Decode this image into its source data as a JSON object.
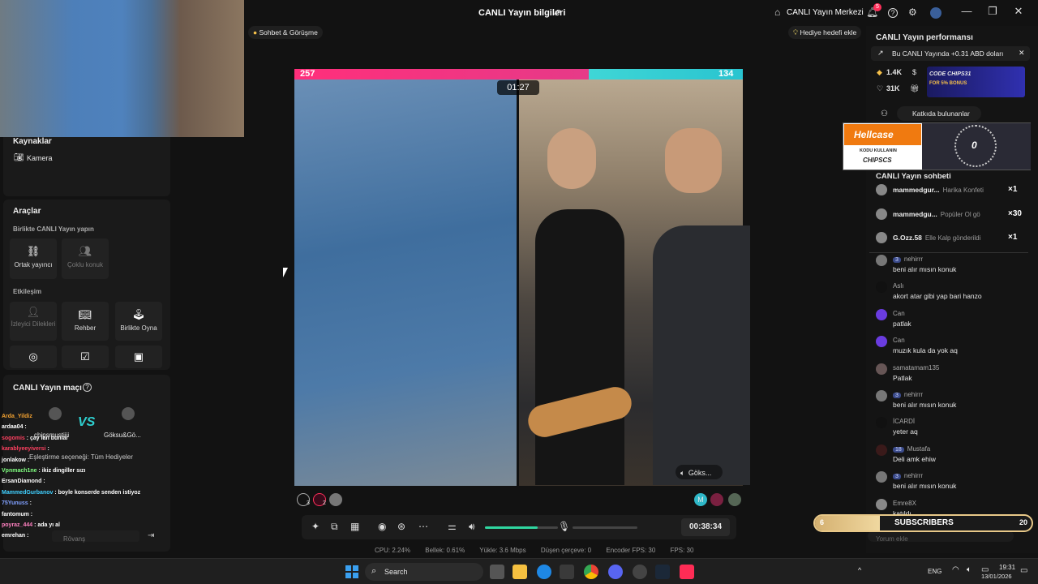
{
  "titlebar": {
    "title": "CANLI Yayın bilgileri",
    "live_center": "CANLI Yayın Merkezi",
    "notification_count": "5",
    "win_minimize": "—",
    "win_maximize": "❐",
    "win_close": "✕"
  },
  "top_pills": {
    "chat_call": "Sohbet & Görüşme",
    "gift_goal": "Hediye hedefi ekle"
  },
  "left": {
    "sources_title": "Kaynaklar",
    "camera_label": "Kamera",
    "tools_title": "Araçlar",
    "together_label": "Birlikte CANLI Yayın yapın",
    "cohost": "Ortak yayıncı",
    "multi_guest": "Çoklu konuk",
    "interaction_label": "Etkileşim",
    "viewer_requests": "İzleyici Dilekleri",
    "guide": "Rehber",
    "play_together": "Birlikte Oyna",
    "match_title": "CANLI Yayın maçı",
    "player1": "chipsmustiiii",
    "player2": "Göksu&Gö...",
    "vs": "VS",
    "rematch_placeholder": "Rövanş",
    "matching_option": "Eşleştirme seçeneği: Tüm Hediyeler"
  },
  "overlay_chat": [
    {
      "name": "Arda_Yildiz",
      "text": "",
      "color": "#f0a030"
    },
    {
      "name": "ardaa04",
      "text": ":",
      "color": "#ffffff"
    },
    {
      "name": "sogomis",
      "text": ": çay lan bunlar",
      "color": "#ff4060"
    },
    {
      "name": "karablyeeyiversi",
      "text": ":",
      "color": "#ff4060"
    },
    {
      "name": "jonlakow",
      "text": ":",
      "color": "#ffffff"
    },
    {
      "name": "Vpnmach1ne",
      "text": ": ikiz dingiller sızı",
      "color": "#80ff80"
    },
    {
      "name": "ErsanDiamond",
      "text": ":",
      "color": "#ffffff"
    },
    {
      "name": "MammedGurbanov",
      "text": ": boyle konserde senden istiyoz",
      "color": "#40d0ff"
    },
    {
      "name": "75Yunuss",
      "text": ":",
      "color": "#80a0ff"
    },
    {
      "name": "fantomum",
      "text": ":",
      "color": "#ffffff"
    },
    {
      "name": "poyraz_444",
      "text": ": ada yı al",
      "color": "#ff80c0"
    },
    {
      "name": "emrehan",
      "text": ":",
      "color": "#ffffff"
    }
  ],
  "stage": {
    "score_left": "257",
    "score_right": "134",
    "timer": "01:27",
    "guest_label": "Göks...",
    "left_badge_1": "3",
    "left_badge_2": "2",
    "right_badge": "M"
  },
  "controls": {
    "elapsed": "00:38:34",
    "volume_level": 0.72
  },
  "stats": {
    "cpu": "CPU: 2.24%",
    "memory": "Bellek: 0.61%",
    "upload": "Yükle: 3.6 Mbps",
    "dropped": "Düşen çerçeve: 0",
    "encoder_fps": "Encoder FPS: 30",
    "fps": "FPS: 30"
  },
  "right": {
    "perf_title": "CANLI Yayın performansı",
    "earnings": "Bu CANLI Yayında +0.31 ABD doları",
    "diamonds": "1.4K",
    "likes": "31K",
    "contributors": "Katkıda bulunanlar",
    "code_ad_1": "CODE CHIPS31",
    "code_ad_2": "FOR 5% BONUS",
    "hellcase_title": "Hellcase",
    "hellcase_sub1": "KODU KULLANIN",
    "hellcase_sub2": "CHIPSCS",
    "hellcase_counter": "0",
    "chat_title": "CANLI Yayın sohbeti",
    "gifts": [
      {
        "name": "mammedgur...",
        "text": "Harika Konfeti",
        "count": "×1"
      },
      {
        "name": "mammedgu...",
        "text": "Popüler Ol gö",
        "count": "×30"
      },
      {
        "name": "G.Ozz.58",
        "text": "Elle Kalp gönderildi",
        "count": "×1"
      }
    ],
    "messages": [
      {
        "name": "nehirrr",
        "badge": "3",
        "text": "beni alır mısın konuk",
        "avatar": "#777777"
      },
      {
        "name": "Aslı",
        "badge": "",
        "text": "akort atar gibi yap bari hanzo",
        "avatar": "#111111"
      },
      {
        "name": "Can",
        "badge": "",
        "text": "patlak",
        "avatar": "#6a3ce0"
      },
      {
        "name": "Can",
        "badge": "",
        "text": "muzık kula da yok aq",
        "avatar": "#6a3ce0"
      },
      {
        "name": "samatamam135",
        "badge": "",
        "text": "Patlak",
        "avatar": "#665555"
      },
      {
        "name": "nehirrr",
        "badge": "3",
        "text": "beni alır mısın konuk",
        "avatar": "#777777"
      },
      {
        "name": "İCARDİ",
        "badge": "",
        "text": "yeter aq",
        "avatar": "#111111"
      },
      {
        "name": "Mustafa",
        "badge": "18",
        "text": "Deli amk ehiw",
        "avatar": "#3a1a1a"
      },
      {
        "name": "nehirrr",
        "badge": "3",
        "text": "beni alır mısın konuk",
        "avatar": "#777777"
      },
      {
        "name": "Emre8X",
        "badge": "",
        "text": "katıldı",
        "avatar": "#888888"
      }
    ],
    "comment_placeholder": "Yorum ekle",
    "subs_left": "6",
    "subs_label": "SUBSCRIBERS",
    "subs_right": "20"
  },
  "taskbar": {
    "search": "Search",
    "lang": "ENG",
    "time": "19:31",
    "date": "13/01/2026"
  }
}
